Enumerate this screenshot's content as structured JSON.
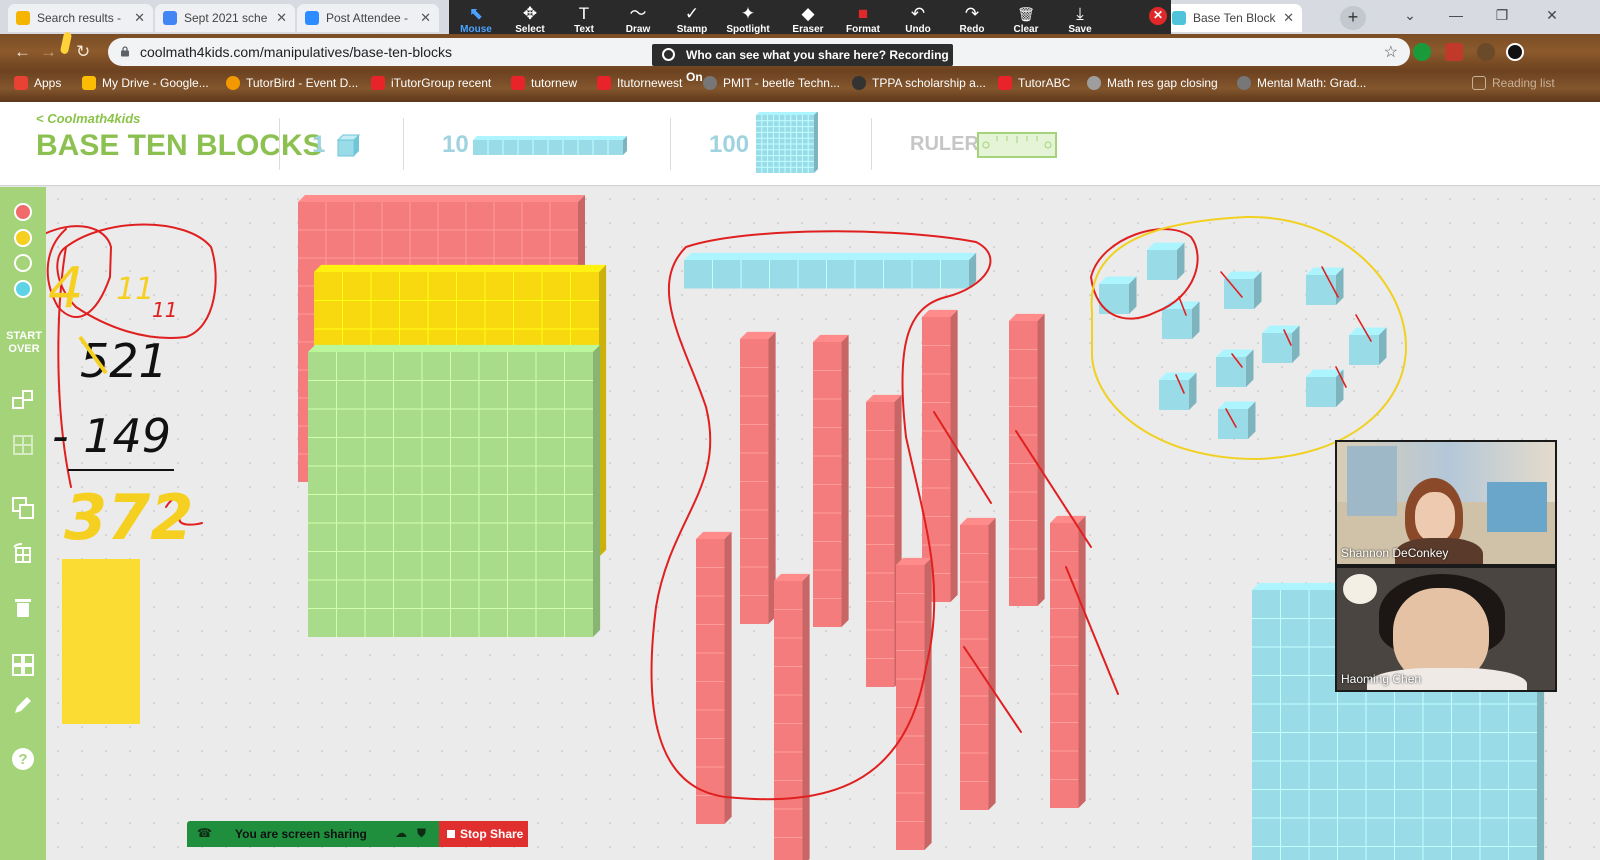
{
  "browser": {
    "tabs": [
      {
        "title": "Search results -",
        "favicon_color": "#f4b400",
        "active": false
      },
      {
        "title": "Sept 2021 sche",
        "favicon_color": "#4285f4",
        "active": false
      },
      {
        "title": "Post Attendee -",
        "favicon_color": "#2d8cff",
        "active": false
      },
      {
        "title": "Base Ten Block",
        "favicon_color": "#4fc3d9",
        "active": true
      }
    ],
    "url": "coolmath4kids.com/manipulatives/base-ten-blocks",
    "bookmarks": [
      {
        "label": "Apps",
        "color": "#e94235"
      },
      {
        "label": "My Drive - Google...",
        "color": "#fbbc04"
      },
      {
        "label": "TutorBird - Event D...",
        "color": "#f29900"
      },
      {
        "label": "iTutorGroup recent",
        "color": "#e8232a"
      },
      {
        "label": "tutornew",
        "color": "#e8232a"
      },
      {
        "label": "Itutornewest",
        "color": "#e8232a"
      },
      {
        "label": "PMIT - beetle Techn...",
        "color": "#777777"
      },
      {
        "label": "TPPA scholarship a...",
        "color": "#333333"
      },
      {
        "label": "TutorABC",
        "color": "#e8232a"
      },
      {
        "label": "Math res gap closing",
        "color": "#9e9e9e"
      },
      {
        "label": "Mental Math: Grad...",
        "color": "#777777"
      },
      {
        "label": "Reading list",
        "color": "#777777"
      }
    ]
  },
  "zoom_toolbar": {
    "tools": [
      {
        "label": "Mouse",
        "icon": "cursor-icon",
        "glyph": "⬉",
        "active": true
      },
      {
        "label": "Select",
        "icon": "move-icon",
        "glyph": "✥"
      },
      {
        "label": "Text",
        "icon": "text-icon",
        "glyph": "T"
      },
      {
        "label": "Draw",
        "icon": "draw-icon",
        "glyph": "〜"
      },
      {
        "label": "Stamp",
        "icon": "stamp-icon",
        "glyph": "✓"
      },
      {
        "label": "Spotlight",
        "icon": "spotlight-icon",
        "glyph": "✦"
      },
      {
        "label": "Eraser",
        "icon": "eraser-icon",
        "glyph": "◆"
      },
      {
        "label": "Format",
        "icon": "format-icon",
        "glyph": "■"
      },
      {
        "label": "Undo",
        "icon": "undo-icon",
        "glyph": "↶"
      },
      {
        "label": "Redo",
        "icon": "redo-icon",
        "glyph": "↷"
      },
      {
        "label": "Clear",
        "icon": "trash-icon",
        "glyph": "🗑"
      },
      {
        "label": "Save",
        "icon": "save-icon",
        "glyph": "⤓"
      }
    ],
    "recording_notice": "Who can see what you share here? Recording On"
  },
  "app": {
    "back_link": "< Coolmath4kids",
    "title": "BASE TEN BLOCKS",
    "palette": [
      {
        "label": "1",
        "kind": "one"
      },
      {
        "label": "10",
        "kind": "ten"
      },
      {
        "label": "100",
        "kind": "hundred"
      },
      {
        "label": "RULER",
        "kind": "ruler"
      }
    ],
    "sidebar_colors": [
      "#f26b6b",
      "#f5d020",
      "#a5d37a",
      "#5fd3e6"
    ],
    "start_over": "START OVER",
    "block_colors": {
      "red": "#f47c7c",
      "yellow": "#f8d80e",
      "green": "#a8dc8a",
      "blue": "#9adbe8"
    }
  },
  "worksheet": {
    "line1": "4",
    "line1_mark": "11",
    "line1_mark2": "11",
    "line2": "521",
    "line3": "- 149",
    "answer": "372"
  },
  "participants": [
    {
      "name": "Shannon DeConkey"
    },
    {
      "name": "Haoming Chen"
    }
  ],
  "share_bar": {
    "status": "You are screen sharing",
    "stop_label": "Stop Share"
  }
}
